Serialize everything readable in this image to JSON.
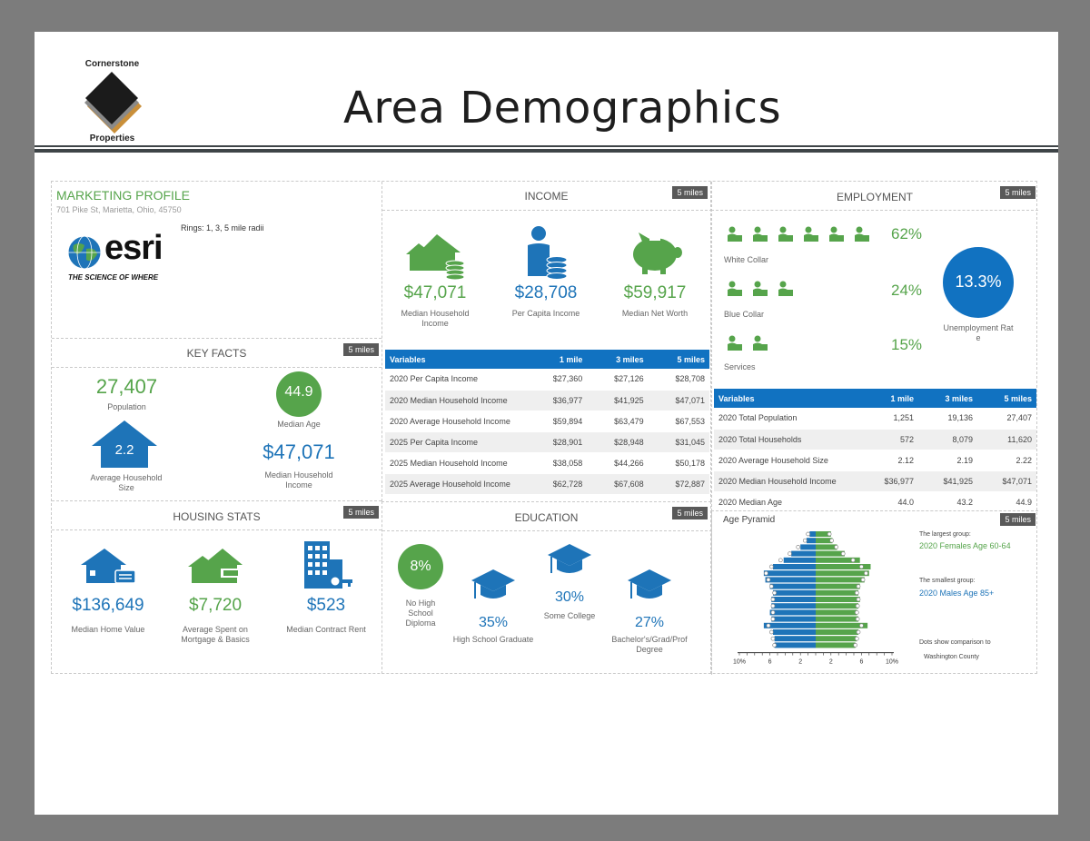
{
  "logo": {
    "top_word": "Cornerstone",
    "bottom_word": "Properties"
  },
  "page_title": "Area Demographics",
  "marketing": {
    "title": "MARKETING PROFILE",
    "address": "701 Pike St, Marietta, Ohio, 45750",
    "rings": "Rings: 1, 3, 5 mile radii",
    "esri_word": "esri",
    "esri_tagline": "THE SCIENCE OF WHERE"
  },
  "key_facts": {
    "title": "KEY FACTS",
    "badge": "5 miles",
    "population_value": "27,407",
    "population_label": "Population",
    "median_age_value": "44.9",
    "median_age_label": "Median Age",
    "household_size_value": "2.2",
    "household_size_label": "Average Household Size",
    "median_income_value": "$47,071",
    "median_income_label": "Median Household Income"
  },
  "housing": {
    "title": "HOUSING STATS",
    "badge": "5 miles",
    "items": [
      {
        "value": "$136,649",
        "label": "Median Home Value"
      },
      {
        "value": "$7,720",
        "label": "Average Spent on Mortgage & Basics"
      },
      {
        "value": "$523",
        "label": "Median Contract Rent"
      }
    ]
  },
  "income": {
    "title": "INCOME",
    "badge": "5 miles",
    "items": [
      {
        "value": "$47,071",
        "label": "Median Household Income"
      },
      {
        "value": "$28,708",
        "label": "Per Capita Income"
      },
      {
        "value": "$59,917",
        "label": "Median Net Worth"
      }
    ],
    "table": {
      "headers": [
        "Variables",
        "1 mile",
        "3 miles",
        "5 miles"
      ],
      "rows": [
        [
          "2020 Per Capita Income",
          "$27,360",
          "$27,126",
          "$28,708"
        ],
        [
          "2020 Median Household Income",
          "$36,977",
          "$41,925",
          "$47,071"
        ],
        [
          "2020 Average Household Income",
          "$59,894",
          "$63,479",
          "$67,553"
        ],
        [
          "2025 Per Capita Income",
          "$28,901",
          "$28,948",
          "$31,045"
        ],
        [
          "2025 Median Household Income",
          "$38,058",
          "$44,266",
          "$50,178"
        ],
        [
          "2025 Average Household Income",
          "$62,728",
          "$67,608",
          "$72,887"
        ]
      ]
    }
  },
  "education": {
    "title": "EDUCATION",
    "badge": "5 miles",
    "items": [
      {
        "value": "8%",
        "label": "No High School Diploma"
      },
      {
        "value": "35%",
        "label": "High School Graduate"
      },
      {
        "value": "30%",
        "label": "Some College"
      },
      {
        "value": "27%",
        "label": "Bachelor's/Grad/Prof Degree"
      }
    ]
  },
  "employment": {
    "title": "EMPLOYMENT",
    "badge": "5 miles",
    "white_collar": {
      "value": "62%",
      "label": "White Collar"
    },
    "blue_collar": {
      "value": "24%",
      "label": "Blue Collar"
    },
    "services": {
      "value": "15%",
      "label": "Services"
    },
    "unemployment": {
      "value": "13.3%",
      "label": "Unemployment Rate"
    },
    "table": {
      "headers": [
        "Variables",
        "1 mile",
        "3 miles",
        "5 miles"
      ],
      "rows": [
        [
          "2020 Total Population",
          "1,251",
          "19,136",
          "27,407"
        ],
        [
          "2020 Total Households",
          "572",
          "8,079",
          "11,620"
        ],
        [
          "2020 Average Household Size",
          "2.12",
          "2.19",
          "2.22"
        ],
        [
          "2020 Median Household Income",
          "$36,977",
          "$41,925",
          "$47,071"
        ],
        [
          "2020 Median Age",
          "44.0",
          "43.2",
          "44.9"
        ]
      ]
    }
  },
  "pyramid": {
    "title": "Age Pyramid",
    "badge": "5 miles",
    "largest_label": "The largest group:",
    "largest_value": "2020 Females Age 60-64",
    "smallest_label": "The smallest group:",
    "smallest_value": "2020 Males Age 85+",
    "dots_note": "Dots show comparison to",
    "dots_county": "Washington County",
    "axis_ticks": [
      "10%",
      "6",
      "2",
      "2",
      "6",
      "10%"
    ],
    "colors": {
      "male": "#1e74b8",
      "female": "#56a44b"
    }
  },
  "chart_data": {
    "type": "bar",
    "title": "Age Pyramid",
    "categories": [
      "85+",
      "80-84",
      "75-79",
      "70-74",
      "65-69",
      "60-64",
      "55-59",
      "50-54",
      "45-49",
      "40-44",
      "35-39",
      "30-34",
      "25-29",
      "20-24",
      "15-19",
      "10-14",
      "5-9",
      "0-4"
    ],
    "series": [],
    "xlim": [
      -10,
      10
    ],
    "male_values": [
      0.8,
      1.2,
      2.0,
      3.2,
      4.2,
      5.6,
      6.8,
      6.6,
      6.0,
      5.6,
      5.8,
      5.8,
      6.0,
      5.8,
      6.8,
      5.6,
      5.4,
      5.4
    ],
    "female_values": [
      2.0,
      2.2,
      2.8,
      3.8,
      5.8,
      7.2,
      7.0,
      6.4,
      5.8,
      5.6,
      5.8,
      5.6,
      5.4,
      5.6,
      6.8,
      5.6,
      5.4,
      5.2
    ],
    "male_county": [
      1.0,
      1.4,
      2.3,
      3.4,
      4.6,
      5.8,
      6.5,
      6.2,
      5.8,
      5.4,
      5.6,
      5.6,
      5.6,
      5.6,
      6.2,
      5.8,
      5.6,
      5.4
    ],
    "female_county": [
      1.8,
      2.1,
      2.7,
      3.6,
      4.9,
      6.0,
      6.6,
      6.2,
      5.6,
      5.4,
      5.6,
      5.5,
      5.4,
      5.5,
      6.0,
      5.6,
      5.4,
      5.2
    ]
  }
}
